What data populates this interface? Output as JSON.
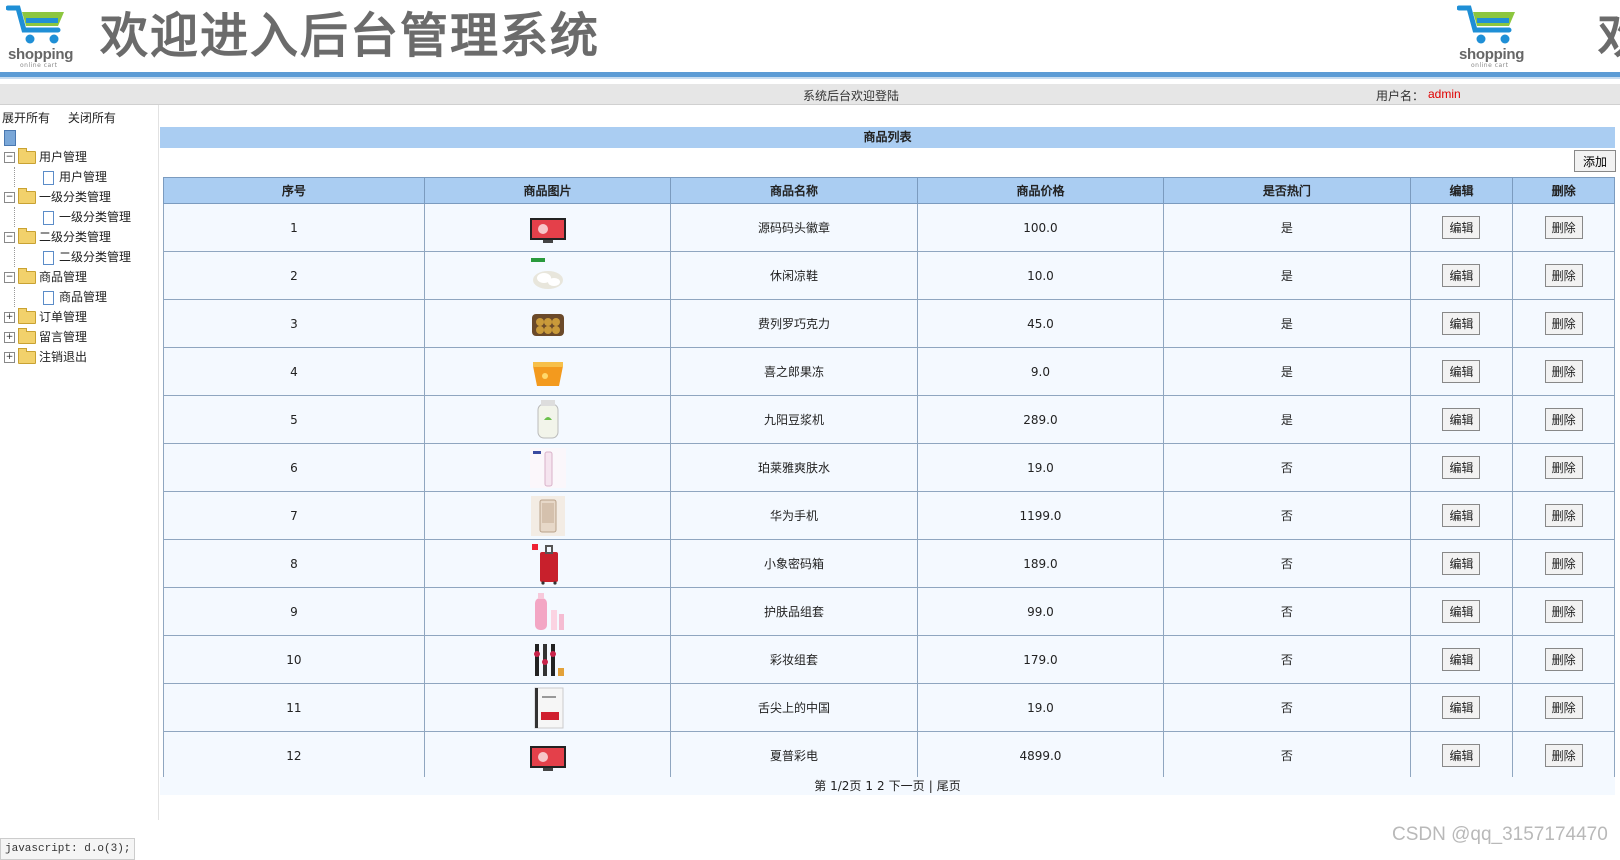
{
  "header": {
    "brand": "shopping",
    "brand_sub": "online cart",
    "title": "欢迎进入后台管理系统",
    "title_partial": "欢"
  },
  "topbar": {
    "welcome": "系统后台欢迎登陆",
    "user_label": "用户名：",
    "user_name": "admin"
  },
  "sidebar": {
    "expand_all": "展开所有",
    "collapse_all": "关闭所有",
    "items": [
      {
        "label": "用户管理",
        "child": "用户管理"
      },
      {
        "label": "一级分类管理",
        "child": "一级分类管理"
      },
      {
        "label": "二级分类管理",
        "child": "二级分类管理"
      },
      {
        "label": "商品管理",
        "child": "商品管理"
      },
      {
        "label": "订单管理"
      },
      {
        "label": "留言管理"
      },
      {
        "label": "注销退出"
      }
    ]
  },
  "main": {
    "list_title": "商品列表",
    "add_label": "添加",
    "columns": [
      "序号",
      "商品图片",
      "商品名称",
      "商品价格",
      "是否热门",
      "编辑",
      "删除"
    ],
    "edit_label": "编辑",
    "delete_label": "删除",
    "rows": [
      {
        "no": "1",
        "name": "源码码头徽章",
        "price": "100.0",
        "hot": "是",
        "img": "tv-red"
      },
      {
        "no": "2",
        "name": "休闲凉鞋",
        "price": "10.0",
        "hot": "是",
        "img": "sandals"
      },
      {
        "no": "3",
        "name": "费列罗巧克力",
        "price": "45.0",
        "hot": "是",
        "img": "chocolate"
      },
      {
        "no": "4",
        "name": "喜之郎果冻",
        "price": "9.0",
        "hot": "是",
        "img": "jelly"
      },
      {
        "no": "5",
        "name": "九阳豆浆机",
        "price": "289.0",
        "hot": "是",
        "img": "soymilk"
      },
      {
        "no": "6",
        "name": "珀莱雅爽肤水",
        "price": "19.0",
        "hot": "否",
        "img": "toner"
      },
      {
        "no": "7",
        "name": "华为手机",
        "price": "1199.0",
        "hot": "否",
        "img": "phone"
      },
      {
        "no": "8",
        "name": "小象密码箱",
        "price": "189.0",
        "hot": "否",
        "img": "luggage"
      },
      {
        "no": "9",
        "name": "护肤品组套",
        "price": "99.0",
        "hot": "否",
        "img": "skincare"
      },
      {
        "no": "10",
        "name": "彩妆组套",
        "price": "179.0",
        "hot": "否",
        "img": "makeup"
      },
      {
        "no": "11",
        "name": "舌尖上的中国",
        "price": "19.0",
        "hot": "否",
        "img": "book"
      },
      {
        "no": "12",
        "name": "夏普彩电",
        "price": "4899.0",
        "hot": "否",
        "img": "tv-red"
      }
    ],
    "pager": {
      "page_info": "第 1/2页",
      "p1": "1",
      "p2": "2",
      "next": "下一页",
      "sep": "|",
      "last": "尾页"
    }
  },
  "statusbar": "javascript: d.o(3);",
  "watermark": "CSDN @qq_3157174470",
  "colors": {
    "accent_blue": "#aacdf2",
    "rule_blue": "#5b9bd5",
    "username_red": "#e00000"
  }
}
